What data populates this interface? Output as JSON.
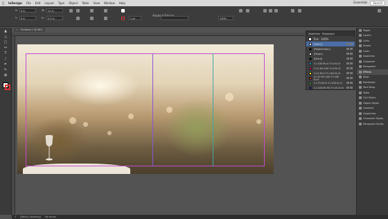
{
  "menubar": {
    "app": "InDesign",
    "items": [
      "File",
      "Edit",
      "Layout",
      "Type",
      "Object",
      "Table",
      "View",
      "Window",
      "Help"
    ],
    "essentials": "Essentials",
    "search_placeholder": "Search"
  },
  "document": {
    "title": "Adobe InDesign",
    "tab_label": "*Untitled-1 @ 66%"
  },
  "control": {
    "x_label": "X:",
    "x_value": "0 in",
    "y_label": "Y:",
    "y_value": "0 in",
    "w_label": "W:",
    "w_value": "11 in",
    "h_label": "H:",
    "h_value": "5.5 in",
    "zoom": "100%",
    "stroke_weight": "1 pt"
  },
  "swatches_panel": {
    "tabs": [
      "Swatches",
      "Paragraph"
    ],
    "tint_label": "Tint:",
    "tint_value": "100%",
    "rows": [
      {
        "name": "[None]",
        "color": "#ffffff"
      },
      {
        "name": "[Registration]",
        "color": "#000000"
      },
      {
        "name": "[Paper]",
        "color": "#ffffff"
      },
      {
        "name": "[Black]",
        "color": "#000000"
      },
      {
        "name": "C=100 M=0 Y=0 K=0",
        "color": "#00a0e9"
      },
      {
        "name": "C=0 M=100 Y=0 K=0",
        "color": "#e4007f"
      },
      {
        "name": "C=0 M=0 Y=100 K=0",
        "color": "#fff100"
      },
      {
        "name": "C=15 M=100 Y=100 K=0",
        "color": "#c8161d"
      },
      {
        "name": "C=75 M=5 Y=100 K=0",
        "color": "#3aa935"
      },
      {
        "name": "C=100 M=90 Y=10 K=0",
        "color": "#1d2088"
      }
    ],
    "selected_index": 0
  },
  "dock": {
    "items": [
      "Pages",
      "Layers",
      "Links",
      "Stroke",
      "Color",
      "Swatches",
      "Character",
      "Paragraph",
      "Effects",
      "Align",
      "Pathfinder",
      "Text Wrap",
      "Table",
      "Cell Styles",
      "Object Styles",
      "Gradient",
      "Hyperlinks",
      "Character Styles",
      "Paragraph Styles"
    ],
    "active_index": 8
  },
  "status": {
    "page": "1",
    "style": "[Basic] (working)",
    "preflight": "No errors"
  },
  "colors": {
    "margin_guide": "#c44bd1",
    "column_guide": "#8a56d6",
    "center_guide": "#3fa7a7",
    "selection": "#4b6ea8"
  }
}
